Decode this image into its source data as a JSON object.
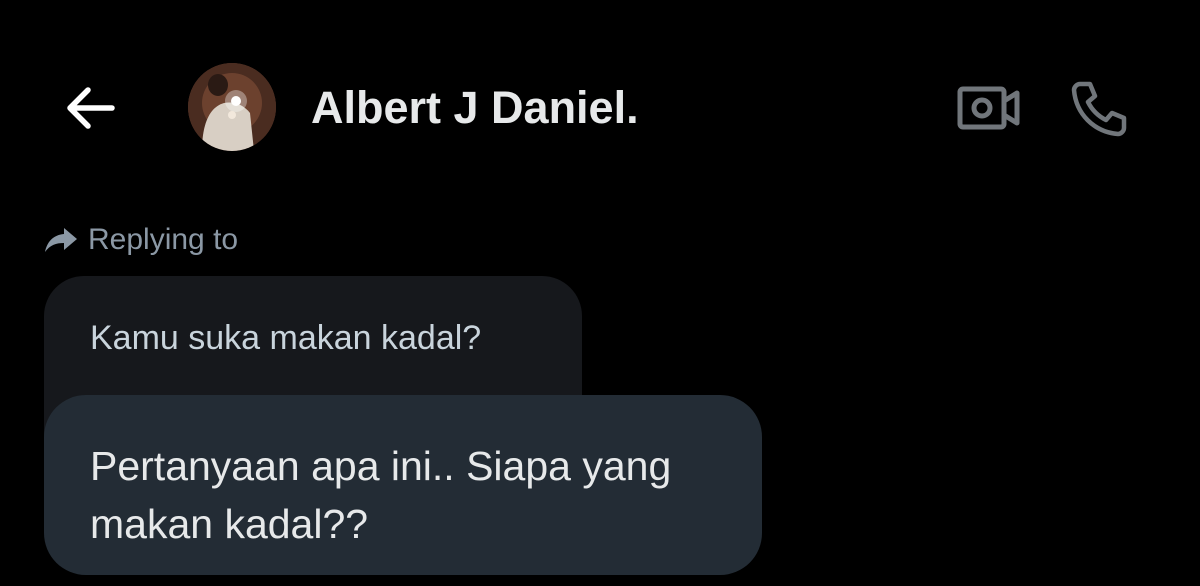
{
  "header": {
    "back_icon": "arrow-left-icon",
    "contact_name": "Albert J Daniel.",
    "video_icon": "video-camera-icon",
    "call_icon": "phone-icon"
  },
  "conversation": {
    "reply_indicator": {
      "icon": "reply-arrow-icon",
      "label": "Replying to"
    },
    "quoted_message": {
      "text": "Kamu suka makan kadal?"
    },
    "message": {
      "text": "Pertanyaan apa ini.. Siapa yang makan kadal??"
    }
  },
  "colors": {
    "background": "#000000",
    "text_primary": "#e7e9ea",
    "text_secondary": "#8b98a5",
    "quoted_bubble": "#16181c",
    "message_bubble": "#232c35",
    "icon_muted": "#71767b"
  }
}
